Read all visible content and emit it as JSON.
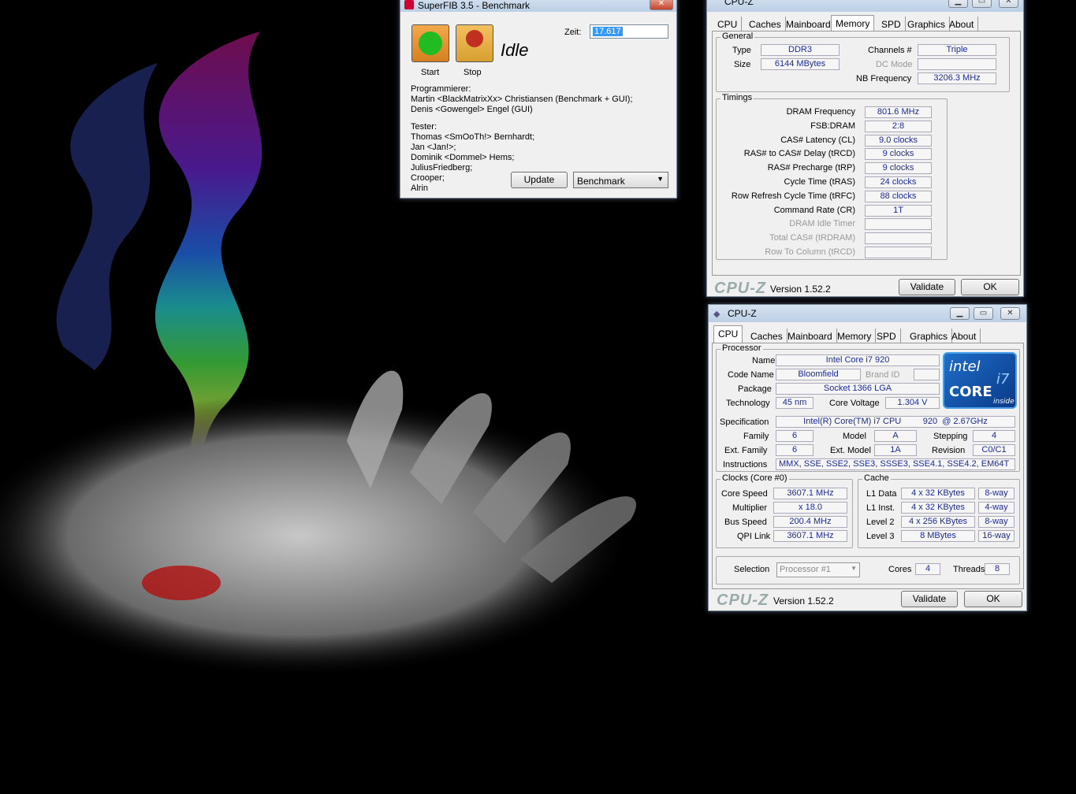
{
  "superfib": {
    "title": "SuperFIB 3.5 - Benchmark",
    "close": "✕",
    "start": "Start",
    "stop": "Stop",
    "status": "Idle",
    "zeit_label": "Zeit:",
    "zeit_value": "17.617",
    "credits": [
      "Programmierer:",
      "Martin <BlackMatrixXx> Christiansen (Benchmark + GUI);",
      "Denis <Gowengel> Engel (GUI)",
      "",
      "Tester:",
      "Thomas <SmOoTh!> Bernhardt;",
      "Jan <Jan!>;",
      "Dominik <Dommel> Hems;",
      "JuliusFriedberg;",
      "Crooper;",
      "Alrin"
    ],
    "update": "Update",
    "mode": "Benchmark"
  },
  "cpuz_mem": {
    "title": "CPU-Z",
    "tabs": [
      "CPU",
      "Caches",
      "Mainboard",
      "Memory",
      "SPD",
      "Graphics",
      "About"
    ],
    "general": "General",
    "type_l": "Type",
    "type_v": "DDR3",
    "size_l": "Size",
    "size_v": "6144 MBytes",
    "channels_l": "Channels #",
    "channels_v": "Triple",
    "dcmode_l": "DC Mode",
    "dcmode_v": "",
    "nbfreq_l": "NB Frequency",
    "nbfreq_v": "3206.3 MHz",
    "timings": "Timings",
    "rows": [
      {
        "l": "DRAM Frequency",
        "v": "801.6 MHz",
        "d": false
      },
      {
        "l": "FSB:DRAM",
        "v": "2:8",
        "d": false
      },
      {
        "l": "CAS# Latency (CL)",
        "v": "9.0 clocks",
        "d": false
      },
      {
        "l": "RAS# to CAS# Delay (tRCD)",
        "v": "9 clocks",
        "d": false
      },
      {
        "l": "RAS# Precharge (tRP)",
        "v": "9 clocks",
        "d": false
      },
      {
        "l": "Cycle Time (tRAS)",
        "v": "24 clocks",
        "d": false
      },
      {
        "l": "Row Refresh Cycle Time (tRFC)",
        "v": "88 clocks",
        "d": false
      },
      {
        "l": "Command Rate (CR)",
        "v": "1T",
        "d": false
      },
      {
        "l": "DRAM Idle Timer",
        "v": "",
        "d": true
      },
      {
        "l": "Total CAS# (tRDRAM)",
        "v": "",
        "d": true
      },
      {
        "l": "Row To Column (tRCD)",
        "v": "",
        "d": true
      }
    ],
    "brand": "CPU-Z",
    "version": "Version 1.52.2",
    "validate": "Validate",
    "ok": "OK"
  },
  "cpuz_cpu": {
    "title": "CPU-Z",
    "tabs": [
      "CPU",
      "Caches",
      "Mainboard",
      "Memory",
      "SPD",
      "Graphics",
      "About"
    ],
    "processor": "Processor",
    "name_l": "Name",
    "name_v": "Intel Core i7 920",
    "codename_l": "Code Name",
    "codename_v": "Bloomfield",
    "brandid_l": "Brand ID",
    "package_l": "Package",
    "package_v": "Socket 1366 LGA",
    "tech_l": "Technology",
    "tech_v": "45 nm",
    "cv_l": "Core Voltage",
    "cv_v": "1.304 V",
    "spec_l": "Specification",
    "spec_v": "Intel(R) Core(TM) i7 CPU         920  @ 2.67GHz",
    "family_l": "Family",
    "family_v": "6",
    "model_l": "Model",
    "model_v": "A",
    "stepping_l": "Stepping",
    "stepping_v": "4",
    "extfam_l": "Ext. Family",
    "extfam_v": "6",
    "extmod_l": "Ext. Model",
    "extmod_v": "1A",
    "rev_l": "Revision",
    "rev_v": "C0/C1",
    "instr_l": "Instructions",
    "instr_v": "MMX, SSE, SSE2, SSE3, SSSE3, SSE4.1, SSE4.2, EM64T",
    "logo_intel": "intel",
    "logo_core": "CORE",
    "logo_i7": "i7",
    "logo_inside": "inside",
    "clocks": "Clocks (Core #0)",
    "cs_l": "Core Speed",
    "cs_v": "3607.1 MHz",
    "mul_l": "Multiplier",
    "mul_v": "x 18.0",
    "bus_l": "Bus Speed",
    "bus_v": "200.4 MHz",
    "qpi_l": "QPI Link",
    "qpi_v": "3607.1 MHz",
    "cache": "Cache",
    "l1d_l": "L1 Data",
    "l1d_v": "4 x 32 KBytes",
    "l1d_w": "8-way",
    "l1i_l": "L1 Inst.",
    "l1i_v": "4 x 32 KBytes",
    "l1i_w": "4-way",
    "l2_l": "Level 2",
    "l2_v": "4 x 256 KBytes",
    "l2_w": "8-way",
    "l3_l": "Level 3",
    "l3_v": "8 MBytes",
    "l3_w": "16-way",
    "sel_l": "Selection",
    "sel_v": "Processor #1",
    "cores_l": "Cores",
    "cores_v": "4",
    "threads_l": "Threads",
    "threads_v": "8",
    "brand": "CPU-Z",
    "version": "Version 1.52.2",
    "validate": "Validate",
    "ok": "OK"
  }
}
